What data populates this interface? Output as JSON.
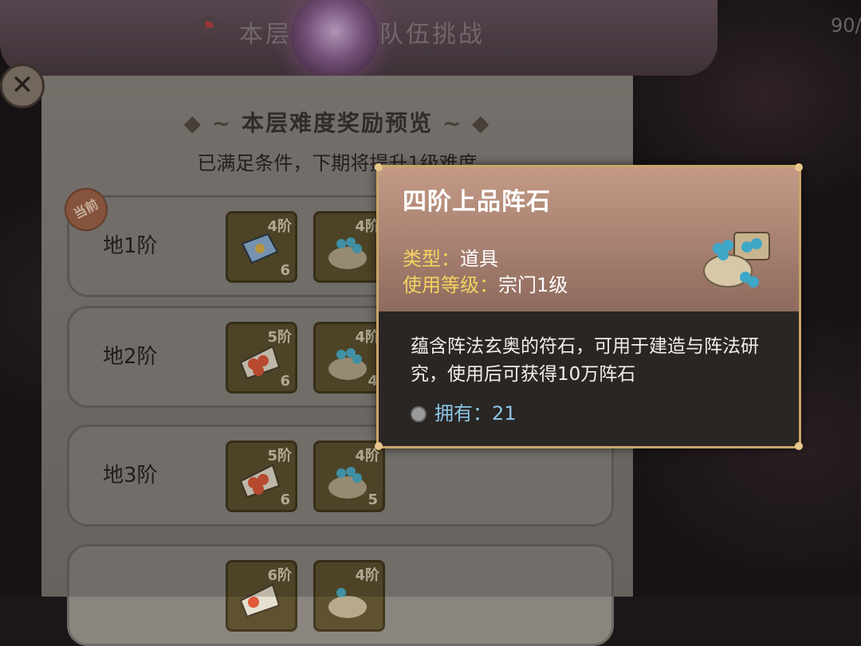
{
  "header": {
    "title": "本层",
    "title_suffix": "队伍挑战",
    "counter": "90/"
  },
  "panel": {
    "title": "本层难度奖励预览",
    "subtitle": "已满足条件，下期将提升1级难度",
    "current_badge": "当前"
  },
  "tiers": [
    {
      "label": "地1阶",
      "items": [
        {
          "tier": "4阶",
          "count": "6",
          "icon": "talisman-icon"
        },
        {
          "tier": "4阶",
          "count": "",
          "icon": "formation-stone-bag-icon"
        }
      ]
    },
    {
      "label": "地2阶",
      "items": [
        {
          "tier": "5阶",
          "count": "6",
          "icon": "pill-scroll-icon"
        },
        {
          "tier": "4阶",
          "count": "4",
          "icon": "formation-stone-bag-icon"
        }
      ]
    },
    {
      "label": "地3阶",
      "items": [
        {
          "tier": "5阶",
          "count": "6",
          "icon": "pill-scroll-icon"
        },
        {
          "tier": "4阶",
          "count": "5",
          "icon": "formation-stone-bag-icon"
        }
      ]
    },
    {
      "label": "",
      "items": [
        {
          "tier": "6阶",
          "count": "",
          "icon": "pill-scroll-icon"
        },
        {
          "tier": "4阶",
          "count": "",
          "icon": "formation-stone-bag-icon"
        }
      ]
    }
  ],
  "tooltip": {
    "name": "四阶上品阵石",
    "type_key": "类型：",
    "type_value": "道具",
    "level_key": "使用等级：",
    "level_value": "宗门1级",
    "description": "蕴含阵法玄奥的符石，可用于建造与阵法研究，使用后可获得10万阵石",
    "own_label": "拥有：",
    "own_value": "21"
  }
}
